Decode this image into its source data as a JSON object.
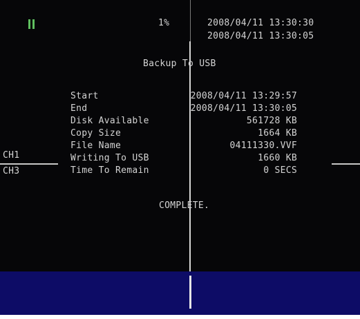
{
  "status": {
    "pause_icon": "pause-icon",
    "progress": "1%",
    "datetime_1": "2008/04/11 13:30:30",
    "datetime_2": "2008/04/11 13:30:05"
  },
  "dialog": {
    "title": "Backup To USB",
    "rows": [
      {
        "label": "Start",
        "value": "2008/04/11 13:29:57"
      },
      {
        "label": "End",
        "value": "2008/04/11 13:30:05"
      },
      {
        "label": "Disk Available",
        "value": "561728 KB"
      },
      {
        "label": "Copy Size",
        "value": "1664 KB"
      },
      {
        "label": "File Name",
        "value": "04111330.VVF"
      },
      {
        "label": "Writing To USB",
        "value": "1660 KB"
      },
      {
        "label": "Time To Remain",
        "value": "0 SECS"
      }
    ],
    "result": "COMPLETE."
  },
  "channels": {
    "ch1": "CH1",
    "ch3": "CH3"
  },
  "colors": {
    "background": "#060608",
    "text": "#d4d4d4",
    "pause_icon": "#5fbf5f",
    "bottom_bar": "#0d0c66"
  }
}
